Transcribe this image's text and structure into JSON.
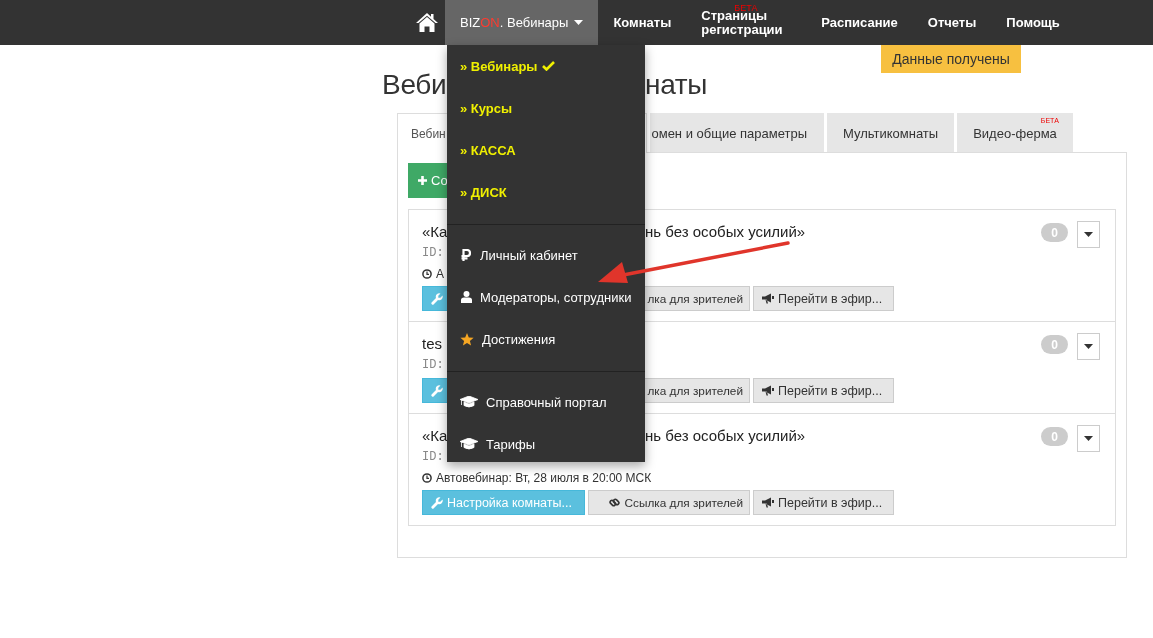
{
  "navbar": {
    "items": [
      {
        "kind": "home",
        "selected": false
      },
      {
        "kind": "brand",
        "prefix": "BIZ",
        "accent": "ON",
        "label": ". Вебинары",
        "selected": true,
        "expanded": true
      },
      {
        "kind": "link",
        "label": "Комнаты",
        "selected": false
      },
      {
        "kind": "link",
        "label": "Страницы регистрации",
        "badge": "БЕТА",
        "selected": false
      },
      {
        "kind": "link",
        "label": "Расписание",
        "selected": false
      },
      {
        "kind": "link",
        "label": "Отчеты",
        "selected": false
      },
      {
        "kind": "link",
        "label": "Помощь",
        "selected": false
      }
    ]
  },
  "notification": "Данные получены",
  "dropdown": {
    "groups": [
      [
        {
          "kind": "section",
          "label": "» Вебинары",
          "selected": true
        },
        {
          "kind": "section",
          "label": "» Курсы",
          "selected": false
        },
        {
          "kind": "section",
          "label": "» КАССА",
          "selected": false
        },
        {
          "kind": "section",
          "label": "» ДИСК",
          "selected": false
        }
      ],
      [
        {
          "kind": "ruble",
          "label": "Личный кабинет"
        },
        {
          "kind": "user",
          "label": "Модераторы, сотрудники"
        },
        {
          "kind": "star",
          "label": "Достижения"
        }
      ],
      [
        {
          "kind": "cap",
          "label": "Справочный портал"
        },
        {
          "kind": "cap",
          "label": "Тарифы"
        }
      ]
    ]
  },
  "page_title": {
    "left": "Веби",
    "right": "наты"
  },
  "tabs": [
    {
      "label": "Вебин",
      "selected": true
    },
    {
      "label": "омен и общие параметры",
      "selected": false
    },
    {
      "label": "Мультикомнаты",
      "selected": false
    },
    {
      "label": "Видео-ферма",
      "badge": "БЕТА",
      "selected": false
    }
  ],
  "create_button": "Со",
  "rooms": [
    {
      "title_left": "«Ка",
      "title_right": "нь без особых усилий»",
      "id_label": "ID:",
      "schedule": "А",
      "count": "0",
      "buttons": [
        {
          "kind": "settings"
        },
        {
          "kind": "link",
          "label": "лка для зрителей"
        },
        {
          "kind": "live",
          "label": "Перейти в эфир..."
        }
      ]
    },
    {
      "title_left": "tes",
      "id_label": "ID:",
      "count": "0",
      "buttons": [
        {
          "kind": "settings"
        },
        {
          "kind": "link",
          "label": "лка для зрителей"
        },
        {
          "kind": "live",
          "label": "Перейти в эфир..."
        }
      ]
    },
    {
      "title_left": "«Ка",
      "title_right": "нь без особых усилий»",
      "id_label": "ID:",
      "schedule": "Автовебинар: Вт, 28 июля в 20:00 МСК",
      "count": "0",
      "buttons": [
        {
          "kind": "settings",
          "label": "Настройка комнаты..."
        },
        {
          "kind": "link",
          "label": "Ссылка для зрителей"
        },
        {
          "kind": "live",
          "label": "Перейти в эфир..."
        }
      ]
    }
  ]
}
